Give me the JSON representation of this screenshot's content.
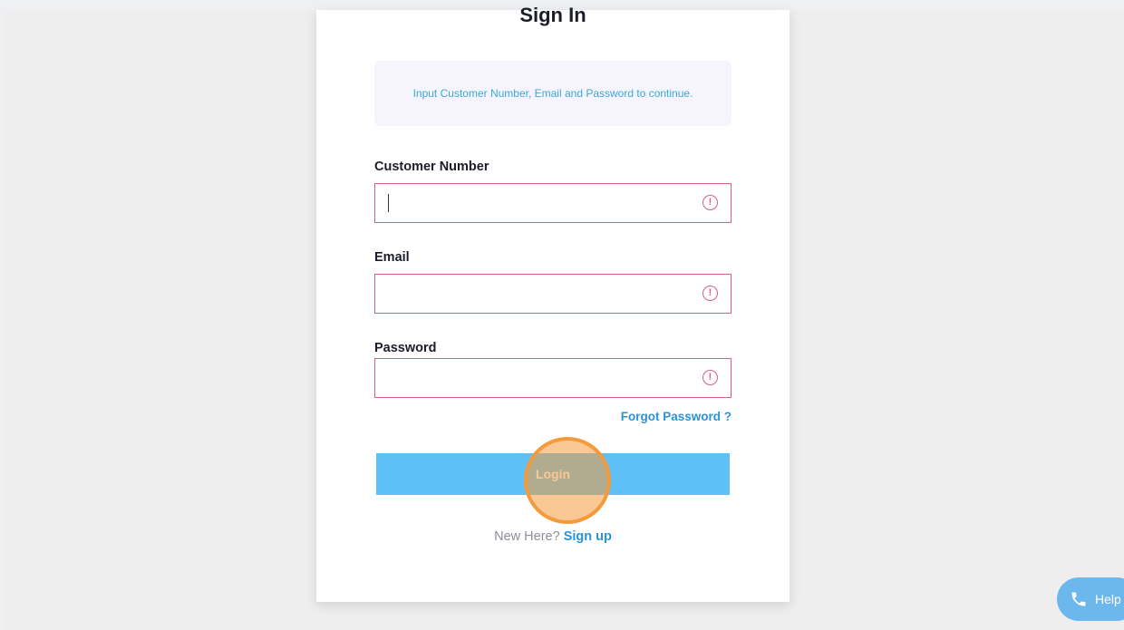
{
  "form": {
    "title": "Sign In",
    "info_message": "Input Customer Number, Email and Password to continue.",
    "customer_number_label": "Customer Number",
    "customer_number_value": "",
    "email_label": "Email",
    "email_value": "",
    "password_label": "Password",
    "password_value": "",
    "error_icon_glyph": "!",
    "forgot_password": "Forgot Password ?",
    "login_label": "Login",
    "new_here": "New Here?",
    "sign_up": "Sign up"
  },
  "help_widget": {
    "label": "Help",
    "icon": "phone-icon"
  },
  "colors": {
    "error_border": "#d9607e",
    "link": "#2b93d6",
    "login_button": "#5ec0f7",
    "info_text": "#3aa8d8",
    "click_marker": "#f59a3c"
  }
}
